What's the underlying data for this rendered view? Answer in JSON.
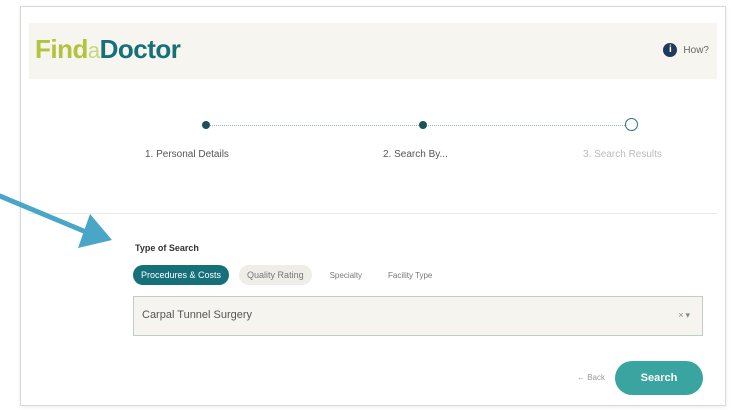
{
  "header": {
    "logo_find": "Find",
    "logo_a": "a",
    "logo_doctor": "Doctor",
    "help_label": "How?"
  },
  "stepper": {
    "steps": [
      {
        "label": "1. Personal Details",
        "status": "done"
      },
      {
        "label": "2. Search By...",
        "status": "current"
      },
      {
        "label": "3. Search Results",
        "status": "todo"
      }
    ]
  },
  "search": {
    "section_title": "Type of Search",
    "tabs": [
      {
        "label": "Procedures & Costs",
        "active": true
      },
      {
        "label": "Quality Rating",
        "active": false
      },
      {
        "label": "Specialty",
        "active": false
      },
      {
        "label": "Facility Type",
        "active": false
      }
    ],
    "selected_value": "Carpal Tunnel Surgery",
    "clear_symbol": "×",
    "dropdown_symbol": "▾"
  },
  "footer": {
    "back_label": "← Back",
    "search_label": "Search"
  },
  "colors": {
    "teal": "#16707a",
    "lime": "#b4c33d",
    "button": "#3aa5a0",
    "arrow": "#4aa6c6"
  },
  "icons": {
    "help": "info-icon",
    "annotation": "arrow-icon"
  }
}
